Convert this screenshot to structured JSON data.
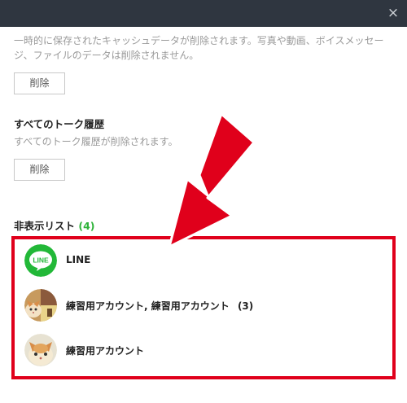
{
  "window": {
    "close_glyph": "×"
  },
  "cache": {
    "description": "一時的に保存されたキャッシュデータが削除されます。写真や動画、ボイスメッセージ、ファイルのデータは削除されません。",
    "delete_label": "削除"
  },
  "talk_history": {
    "title": "すべてのトーク履歴",
    "description": "すべてのトーク履歴が削除されます。",
    "delete_label": "削除"
  },
  "hidden_list": {
    "title": "非表示リスト",
    "count": "(4)",
    "items": [
      {
        "name": "LINE",
        "avatar": "line-logo-icon"
      },
      {
        "name": "練習用アカウント, 練習用アカウント",
        "count": "(3)",
        "avatar": "group-cat-avatar"
      },
      {
        "name": "練習用アカウント",
        "avatar": "cat-avatar"
      }
    ]
  },
  "colors": {
    "titlebar": "#2f3640",
    "highlight": "#e0001b",
    "line_green": "#22b838",
    "count_green": "#2fb33a"
  }
}
